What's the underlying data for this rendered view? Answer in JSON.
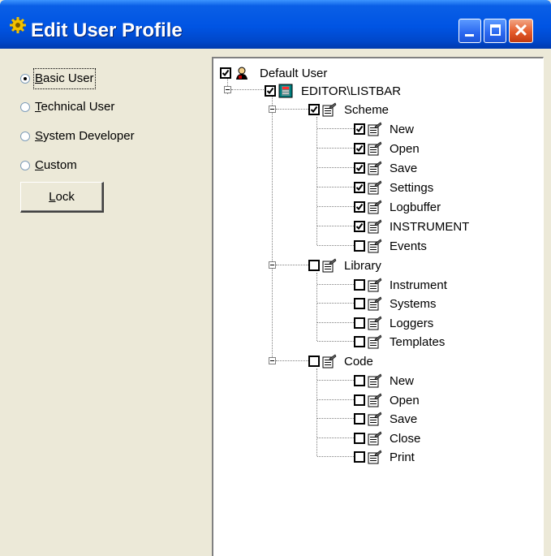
{
  "window": {
    "title": "Edit User Profile"
  },
  "profiles": [
    {
      "label": "Basic User",
      "mnemonic": "B",
      "rest": "asic User",
      "checked": true
    },
    {
      "label": "Technical User",
      "mnemonic": "T",
      "rest": "echnical User",
      "checked": false
    },
    {
      "label": "System Developer",
      "mnemonic": "S",
      "rest": "ystem Developer",
      "checked": false
    },
    {
      "label": "Custom",
      "mnemonic": "C",
      "rest": "ustom",
      "checked": false
    }
  ],
  "lock_button": {
    "mnemonic": "L",
    "rest": "ock"
  },
  "tree": {
    "root": {
      "label": "Default User",
      "checked": true
    },
    "editor": {
      "label": "EDITOR\\LISTBAR",
      "checked": true
    },
    "scheme": {
      "label": "Scheme",
      "checked": true,
      "items": [
        {
          "label": "New",
          "checked": true
        },
        {
          "label": "Open",
          "checked": true
        },
        {
          "label": "Save",
          "checked": true
        },
        {
          "label": "Settings",
          "checked": true
        },
        {
          "label": "Logbuffer",
          "checked": true
        },
        {
          "label": "INSTRUMENT",
          "checked": true
        },
        {
          "label": "Events",
          "checked": false
        }
      ]
    },
    "library": {
      "label": "Library",
      "checked": false,
      "items": [
        {
          "label": "Instrument",
          "checked": false
        },
        {
          "label": "Systems",
          "checked": false
        },
        {
          "label": "Loggers",
          "checked": false
        },
        {
          "label": "Templates",
          "checked": false
        }
      ]
    },
    "code": {
      "label": "Code",
      "checked": false,
      "items": [
        {
          "label": "New",
          "checked": false
        },
        {
          "label": "Open",
          "checked": false
        },
        {
          "label": "Save",
          "checked": false
        },
        {
          "label": "Close",
          "checked": false
        },
        {
          "label": "Print",
          "checked": false
        }
      ]
    }
  },
  "icons": {
    "app": "gear-icon",
    "root": "user-icon",
    "editor": "listbar-icon",
    "node": "document-icon"
  },
  "colors": {
    "titlebar": "#0054e3",
    "close": "#e55b2a",
    "face": "#ece9d8"
  }
}
